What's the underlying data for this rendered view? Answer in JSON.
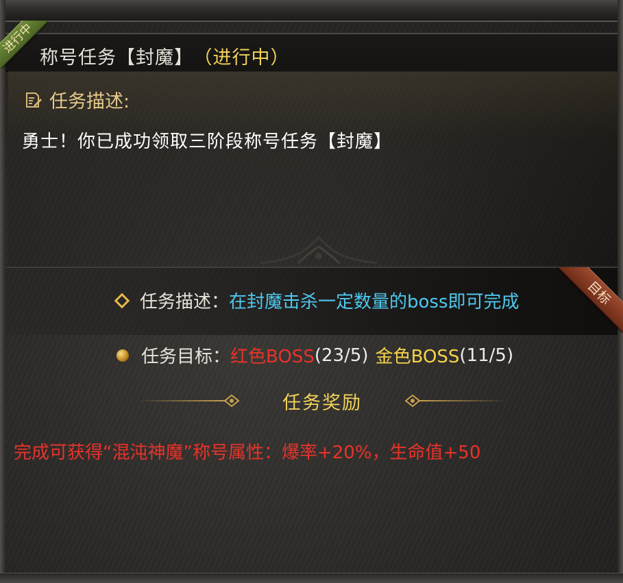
{
  "corner_badge": "进行中",
  "header": {
    "title": "称号任务【封魔】",
    "status": "（进行中）"
  },
  "description": {
    "heading": "任务描述:",
    "text": "勇士！你已成功领取三阶段称号任务【封魔】"
  },
  "target_badge": "目标",
  "task": {
    "desc_label": "任务描述：",
    "desc_value": "在封魔击杀一定数量的boss即可完成",
    "goal_label": "任务目标：",
    "goals": [
      {
        "name": "红色BOSS",
        "progress": "(23/5)",
        "color": "#e8332a"
      },
      {
        "name": "金色BOSS",
        "progress": "(11/5)",
        "color": "#f5d34a"
      }
    ]
  },
  "reward": {
    "title": "任务奖励",
    "text": "完成可获得“混沌神魔”称号属性：爆率+20%，生命值+50"
  },
  "icons": {
    "desc_icon": "scroll-pen-icon",
    "diamond_bullet": "diamond-bullet-icon",
    "dot_bullet": "orb-bullet-icon"
  }
}
